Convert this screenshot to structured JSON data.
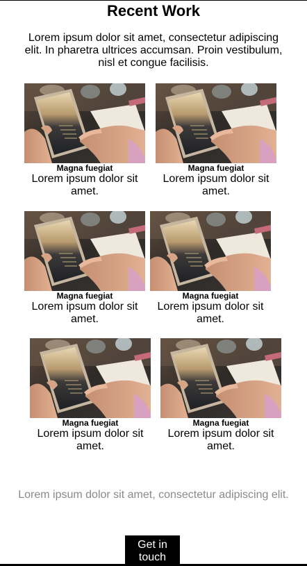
{
  "header": {
    "title": "Recent Work",
    "intro": "Lorem ipsum dolor sit amet, consectetur adipiscing elit. In pharetra ultrices accumsan. Proin vestibulum, nisl et congue facilisis."
  },
  "gallery": {
    "items": [
      {
        "title": "Magna fuegiat",
        "text": "Lorem ipsum dolor sit amet.",
        "image": "tablet-photo"
      },
      {
        "title": "Magna fuegiat",
        "text": "Lorem ipsum dolor sit amet.",
        "image": "tablet-photo"
      },
      {
        "title": "Magna fuegiat",
        "text": "Lorem ipsum dolor sit amet.",
        "image": "tablet-photo"
      },
      {
        "title": "Magna fuegiat",
        "text": "Lorem ipsum dolor sit amet.",
        "image": "tablet-photo"
      },
      {
        "title": "Magna fuegiat",
        "text": "Lorem ipsum dolor sit amet.",
        "image": "tablet-photo"
      },
      {
        "title": "Magna fuegiat",
        "text": "Lorem ipsum dolor sit amet.",
        "image": "tablet-photo"
      }
    ]
  },
  "footer": {
    "text": "Lorem ipsum dolor sit amet, consectetur adipiscing elit.",
    "button_label": "Get in touch"
  },
  "colors": {
    "button_bg": "#000000",
    "button_text": "#ffffff",
    "footer_text": "#8a8a8a"
  }
}
